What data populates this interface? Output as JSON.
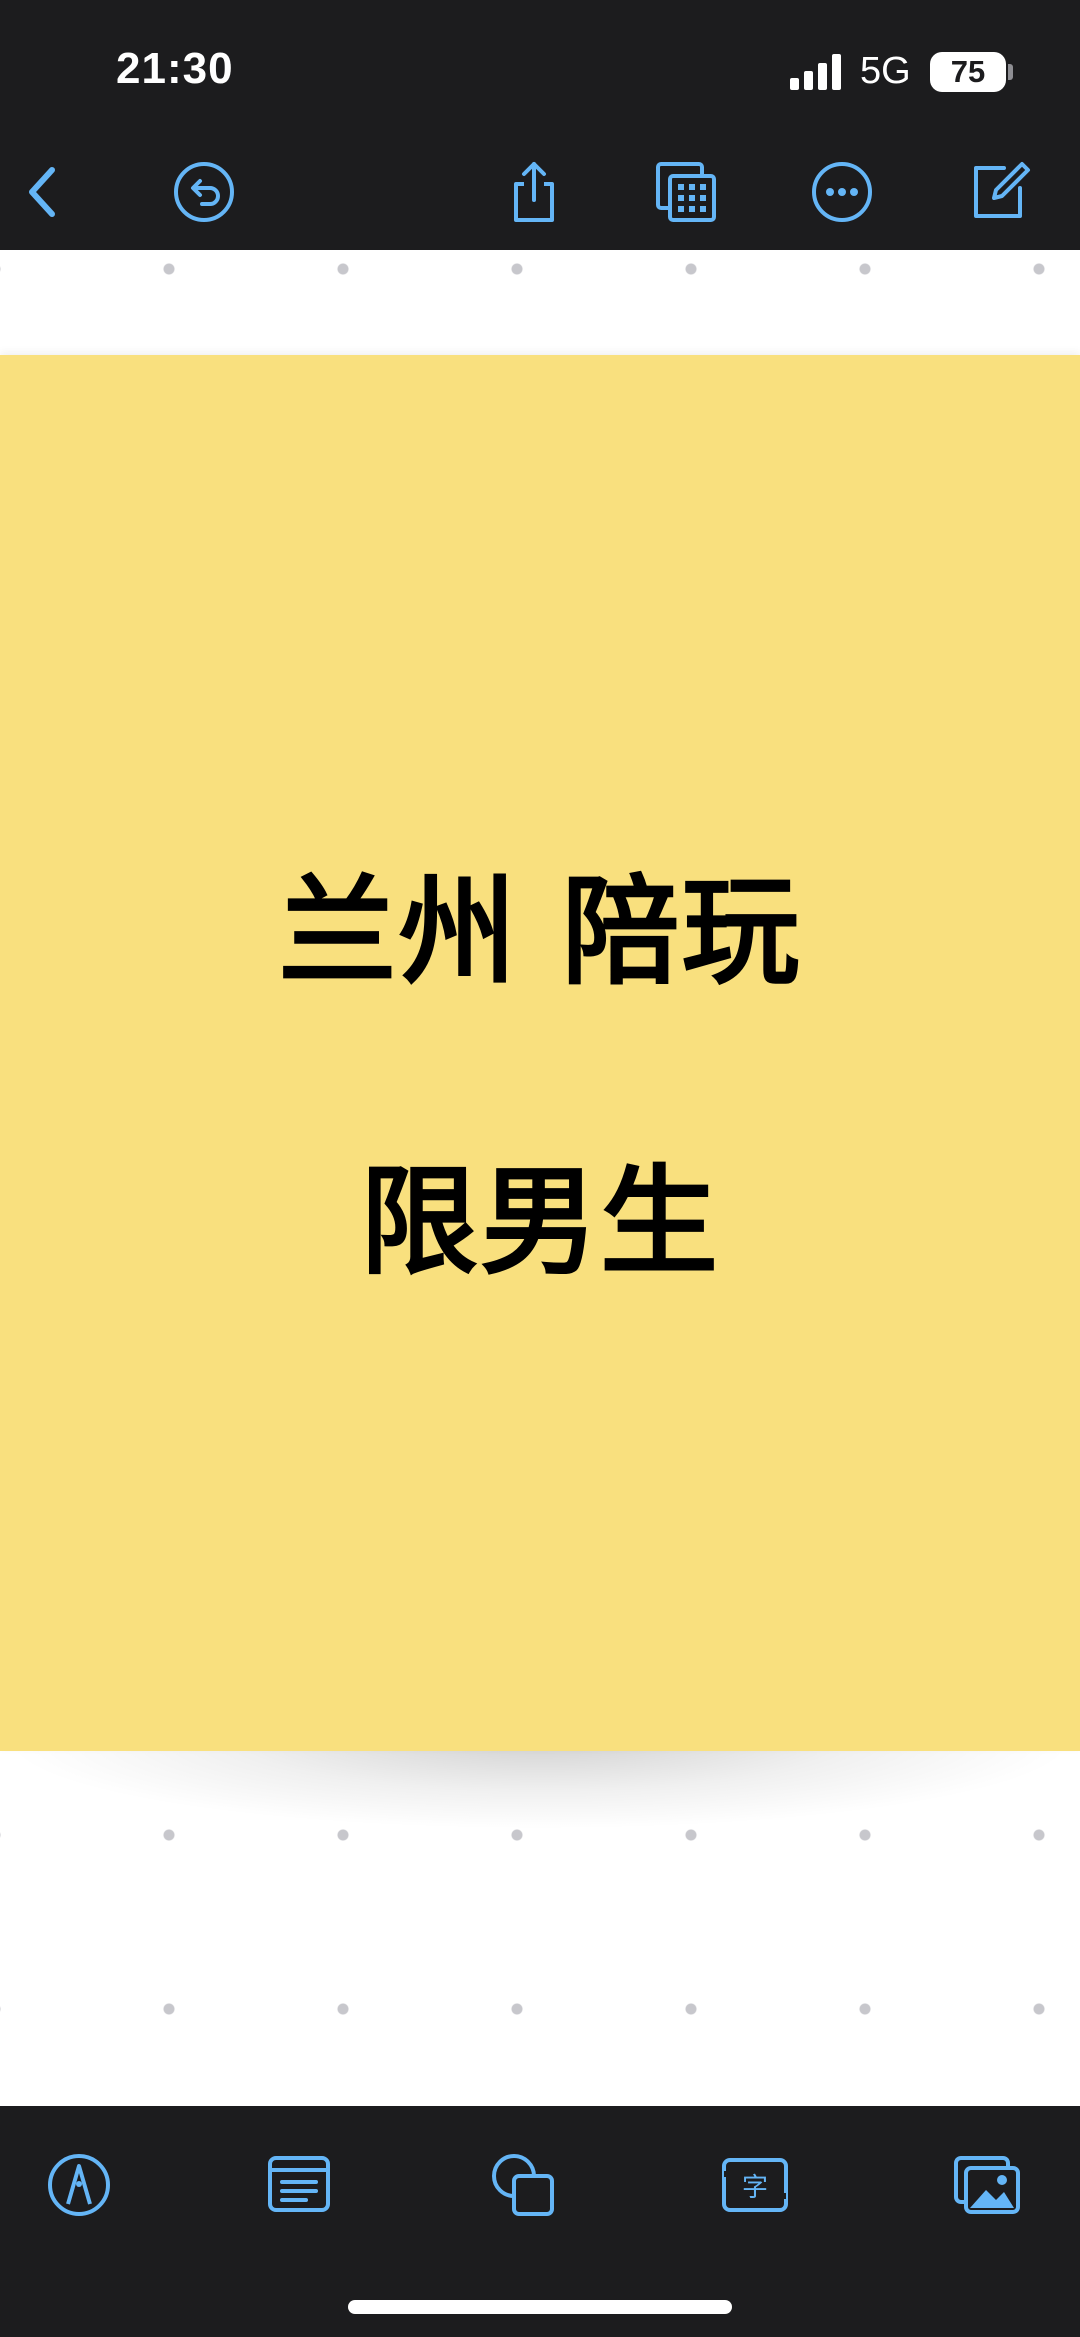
{
  "status_bar": {
    "time": "21:30",
    "network": "5G",
    "battery": "75"
  },
  "toolbar": {
    "icons": [
      "back-chevron-icon",
      "undo-icon",
      "share-icon",
      "grid-view-icon",
      "more-icon",
      "compose-icon"
    ]
  },
  "sheet": {
    "line1": "兰州 陪玩",
    "line2": "限男生",
    "color": "#f9e07e"
  },
  "bottom_toolbar": {
    "icons": [
      "pen-tool-icon",
      "text-box-icon",
      "shapes-icon",
      "text-recognition-icon",
      "photos-icon"
    ]
  },
  "theme": {
    "bar_background": "#1c1c1e",
    "accent": "#64b5f6"
  }
}
